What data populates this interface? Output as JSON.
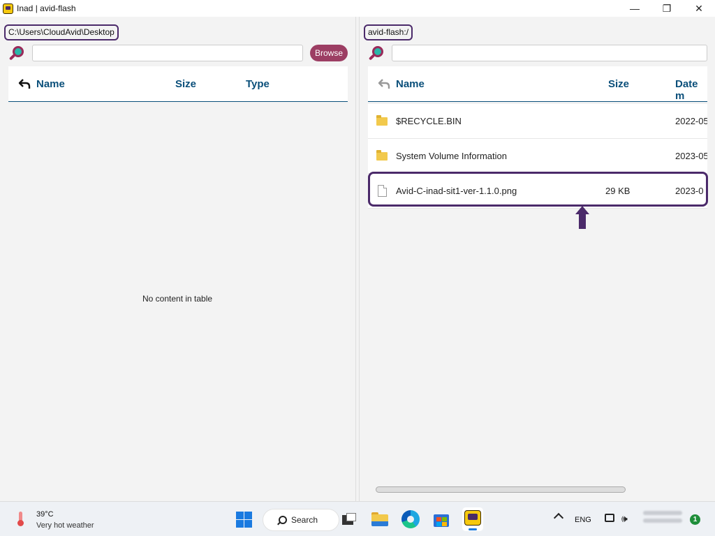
{
  "window": {
    "title": "Inad | avid-flash",
    "minimize_glyph": "—",
    "maximize_glyph": "❐",
    "close_glyph": "✕"
  },
  "left_panel": {
    "path": "C:\\Users\\CloudAvid\\Desktop",
    "search_value": "",
    "browse_label": "Browse",
    "columns": {
      "name": "Name",
      "size": "Size",
      "type": "Type"
    },
    "empty_message": "No content in table"
  },
  "right_panel": {
    "path": "avid-flash:/",
    "search_value": "",
    "columns": {
      "name": "Name",
      "size": "Size",
      "date": "Date m"
    },
    "rows": [
      {
        "icon": "folder-icon",
        "name": "$RECYCLE.BIN",
        "size": "",
        "date": "2022-05"
      },
      {
        "icon": "folder-icon",
        "name": "System Volume Information",
        "size": "",
        "date": "2023-05"
      },
      {
        "icon": "file-icon",
        "name": "Avid-C-inad-sit1-ver-1.1.0.png",
        "size": "29 KB",
        "date": "2023-0"
      }
    ]
  },
  "taskbar": {
    "weather_temp": "39°C",
    "weather_desc": "Very hot weather",
    "search_label": "Search",
    "language": "ENG",
    "volume_glyph": "🕪",
    "notification_count": "1"
  },
  "colors": {
    "accent_purple": "#4b2a6a",
    "header_blue": "#0a4f7a",
    "browse_button": "#9c3e63"
  }
}
